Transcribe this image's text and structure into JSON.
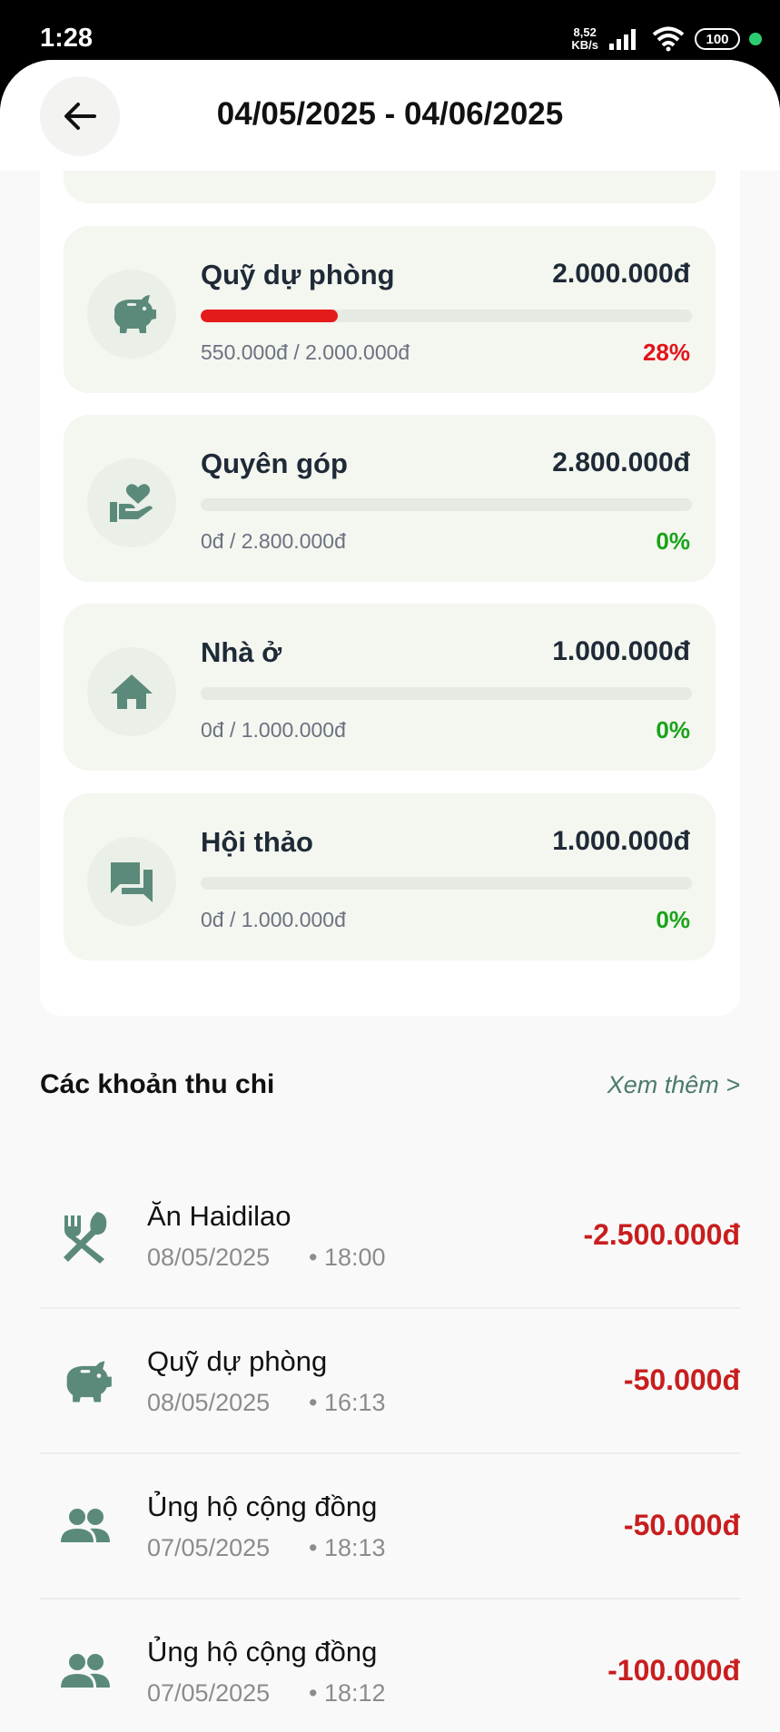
{
  "status_bar": {
    "time": "1:28",
    "net_speed_value": "8,52",
    "net_speed_unit": "KB/s",
    "battery": "100",
    "icons": [
      "signal-icon",
      "wifi-icon",
      "battery-icon"
    ]
  },
  "header": {
    "title": "04/05/2025 - 04/06/2025",
    "back_icon": "arrow-left-icon"
  },
  "budgets": [
    {
      "name": "Quỹ dự phòng",
      "total": "2.000.000đ",
      "progress_text": "550.000đ / 2.000.000đ",
      "percent": "28%",
      "fraction": 0.28,
      "icon": "piggy-bank-icon",
      "percent_color": "#e3131b"
    },
    {
      "name": "Quyên góp",
      "total": "2.800.000đ",
      "progress_text": "0đ / 2.800.000đ",
      "percent": "0%",
      "fraction": 0,
      "icon": "donation-hand-heart-icon",
      "percent_color": "#19a319"
    },
    {
      "name": "Nhà ở",
      "total": "1.000.000đ",
      "progress_text": "0đ / 1.000.000đ",
      "percent": "0%",
      "fraction": 0,
      "icon": "home-icon",
      "percent_color": "#19a319"
    },
    {
      "name": "Hội thảo",
      "total": "1.000.000đ",
      "progress_text": "0đ / 1.000.000đ",
      "percent": "0%",
      "fraction": 0,
      "icon": "chat-bubbles-icon",
      "percent_color": "#19a319"
    }
  ],
  "transactions_section": {
    "title": "Các khoản thu chi",
    "see_more": "Xem thêm >"
  },
  "transactions": [
    {
      "name": "Ăn Haidilao",
      "date": "08/05/2025",
      "time": "• 18:00",
      "amount": "-2.500.000đ",
      "icon": "fork-spoon-icon"
    },
    {
      "name": "Quỹ dự phòng",
      "date": "08/05/2025",
      "time": "• 16:13",
      "amount": "-50.000đ",
      "icon": "piggy-bank-icon"
    },
    {
      "name": "Ủng hộ cộng đồng",
      "date": "07/05/2025",
      "time": "• 18:13",
      "amount": "-50.000đ",
      "icon": "people-icon"
    },
    {
      "name": "Ủng hộ cộng đồng",
      "date": "07/05/2025",
      "time": "• 18:12",
      "amount": "-100.000đ",
      "icon": "people-icon"
    }
  ],
  "colors": {
    "accent_icon": "#5b8a7a",
    "over_budget": "#e51b1b",
    "expense_amount": "#c81e1e",
    "zero_percent": "#19a319"
  }
}
